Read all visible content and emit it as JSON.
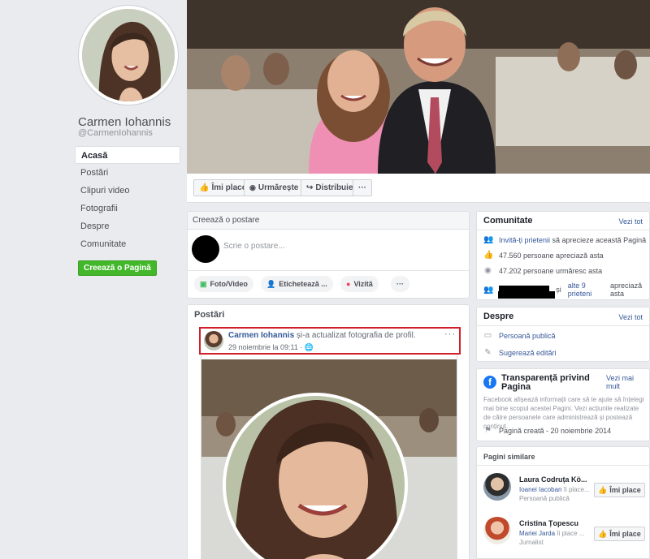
{
  "profile": {
    "name": "Carmen Iohannis",
    "handle": "@CarmenIohannis"
  },
  "nav": {
    "items": [
      "Acasă",
      "Postări",
      "Clipuri video",
      "Fotografii",
      "Despre",
      "Comunitate"
    ],
    "create_page": "Creează o Pagină"
  },
  "actions": {
    "like": "Îmi place",
    "follow": "Urmărește",
    "share": "Distribuie",
    "more": "···"
  },
  "composer": {
    "title": "Creează o postare",
    "placeholder": "Scrie o postare...",
    "photo": "Foto/Video",
    "tag": "Etichetează ...",
    "checkin": "Vizită",
    "more": "···"
  },
  "posts": {
    "title": "Postări",
    "author": "Carmen Iohannis",
    "action": "și-a actualizat fotografia de profil.",
    "time": "29 noiembrie la 09:11",
    "more": "···"
  },
  "community": {
    "title": "Comunitate",
    "see_all": "Vezi tot",
    "invite_link": "Invită-ți prietenii",
    "invite_rest": "să aprecieze această Pagină",
    "likes": "47.560 persoane apreciază asta",
    "follows": "47.202 persoane urmăresc asta",
    "friends_mid": "și",
    "friends_link": "alte 9 prieteni",
    "friends_rest": "apreciază asta"
  },
  "about": {
    "title": "Despre",
    "see_all": "Vezi tot",
    "category": "Persoană publică",
    "suggest": "Sugerează editări"
  },
  "transparency": {
    "title": "Transparență privind Pagina",
    "see_more": "Vezi mai mult",
    "text": "Facebook afișează informații care să te ajute să înțelegi mai bine scopul acestei Pagini. Vezi acțiunile realizate de către persoanele care administrează și postează conținut.",
    "created": "Pagină creată - 20 noiembrie 2014"
  },
  "similar": {
    "title": "Pagini similare",
    "pages": [
      {
        "name": "Laura Codruța Kö...",
        "liker": "Ioanei Iacoban",
        "liker_rest": "îi place...",
        "category": "Persoană publică",
        "like": "Îmi place"
      },
      {
        "name": "Cristina Țopescu",
        "liker": "Mariei Jarda",
        "liker_rest": "îi place ...",
        "category": "Jurnalist",
        "like": "Îmi place"
      }
    ]
  },
  "icons": {
    "like": "thumbs-up-icon",
    "follow": "rss-icon",
    "share": "share-arrow-icon",
    "globe": "globe-icon"
  },
  "colors": {
    "link": "#365899",
    "highlight": "#d0202b",
    "create": "#42b72a",
    "fb_blue": "#1877f2"
  }
}
